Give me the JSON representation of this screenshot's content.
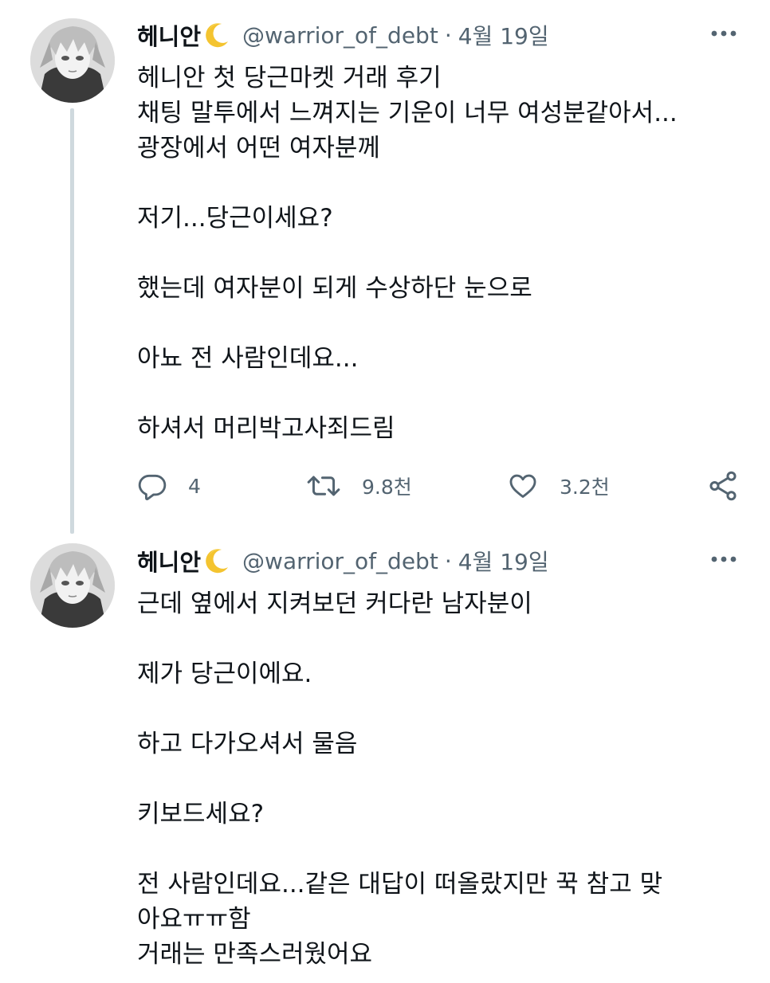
{
  "tweets": [
    {
      "author": {
        "display_name": "헤니안",
        "name_emoji": "crescent-moon-icon",
        "handle": "@warrior_of_debt",
        "separator": "·",
        "date": "4월 19일"
      },
      "body": "헤니안 첫 당근마켓 거래 후기\n채팅 말투에서 느껴지는 기운이 너무 여성분같아서...\n광장에서 어떤 여자분께\n\n저기...당근이세요?\n\n했는데 여자분이 되게 수상하단 눈으로\n\n아뇨 전 사람인데요...\n\n하셔서 머리박고사죄드림",
      "actions": {
        "reply_count": "4",
        "retweet_count": "9.8천",
        "like_count": "3.2천"
      }
    },
    {
      "author": {
        "display_name": "헤니안",
        "name_emoji": "crescent-moon-icon",
        "handle": "@warrior_of_debt",
        "separator": "·",
        "date": "4월 19일"
      },
      "body": "근데 옆에서 지켜보던 커다란 남자분이\n\n제가 당근이에요.\n\n하고 다가오셔서 물음\n\n키보드세요?\n\n전 사람인데요...같은 대답이 떠올랐지만 꾹 참고 맞\n아요ㅠㅠ함\n거래는 만족스러웠어요"
    }
  ],
  "icons": {
    "more": "more-dots-icon",
    "reply": "reply-icon",
    "retweet": "retweet-icon",
    "like": "heart-icon",
    "share": "share-icon"
  },
  "colors": {
    "text_primary": "#0f1419",
    "text_secondary": "#536471",
    "thread_line": "#cfd9de",
    "moon": "#f4c430"
  }
}
